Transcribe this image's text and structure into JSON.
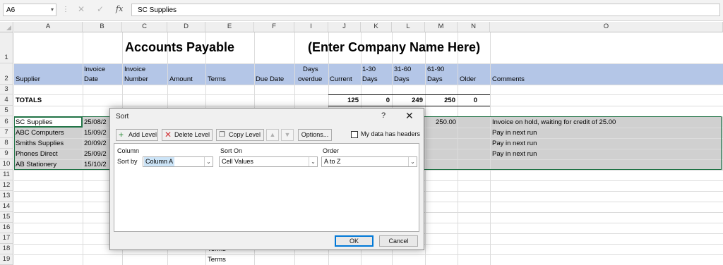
{
  "formula_bar": {
    "name_box": "A6",
    "name_box_arrow": "▾",
    "separator": "⋮",
    "cancel_glyph": "✕",
    "enter_glyph": "✓",
    "fx": "fx",
    "content": "SC Supplies"
  },
  "columns": [
    "A",
    "B",
    "C",
    "D",
    "E",
    "F",
    "I",
    "J",
    "K",
    "L",
    "M",
    "N",
    "O"
  ],
  "rows": [
    "1",
    "2",
    "3",
    "4",
    "5",
    "6",
    "7",
    "8",
    "9",
    "10",
    "11",
    "12",
    "13",
    "14",
    "15",
    "16",
    "17",
    "18",
    "19"
  ],
  "sheet": {
    "title": "Accounts Payable",
    "company_placeholder": "(Enter Company Name Here)",
    "header_row_top": [
      "Invoice",
      "Invoice",
      "Days",
      "1-30",
      "31-60",
      "61-90"
    ],
    "header_row_bottom": [
      "Supplier",
      "Date",
      "Number",
      "Amount",
      "Terms",
      "Due Date",
      "overdue",
      "Current",
      "Days",
      "Days",
      "Days",
      "Older",
      "Comments"
    ],
    "totals_label": "TOTALS",
    "totals": [
      "125",
      "0",
      "249",
      "250",
      "0"
    ],
    "data_rows": [
      {
        "supplier": "SC Supplies",
        "date": "25/08/2",
        "comment": "Invoice on hold, waiting for credit of 25.00"
      },
      {
        "supplier": "ABC Computers",
        "date": "15/09/2",
        "comment": "Pay in next run"
      },
      {
        "supplier": "Smiths Supplies",
        "date": "20/09/2",
        "comment": "Pay in next run"
      },
      {
        "supplier": "Phones Direct",
        "date": "25/09/2",
        "comment": "Pay in next run"
      },
      {
        "supplier": "AB Stationery",
        "date": "15/10/2",
        "comment": ""
      }
    ],
    "row6_days_61_90": "250.00",
    "peek_values": [
      "0",
      "0",
      "0"
    ],
    "terms_text": [
      "Terms",
      "Terms"
    ]
  },
  "colors": {
    "header_band": "#b4c6e7",
    "data_band": "#d0d0d0",
    "selection_border": "#217346",
    "ok_focus": "#0078d7"
  },
  "dialog": {
    "title": "Sort",
    "help": "?",
    "close": "✕",
    "add_level": "Add Level",
    "delete_level": "Delete Level",
    "copy_level": "Copy Level",
    "move_up": "▲",
    "move_down": "▼",
    "options": "Options...",
    "headers_checkbox_label": "My data has headers",
    "headers_checked": false,
    "col_header": "Column",
    "sort_on_header": "Sort On",
    "order_header": "Order",
    "sort_by_label": "Sort by",
    "column_value": "Column A",
    "sort_on_value": "Cell Values",
    "order_value": "A to Z",
    "ok": "OK",
    "cancel": "Cancel",
    "icons": {
      "add": "add-level-icon",
      "delete": "delete-level-icon",
      "copy": "copy-level-icon"
    }
  }
}
